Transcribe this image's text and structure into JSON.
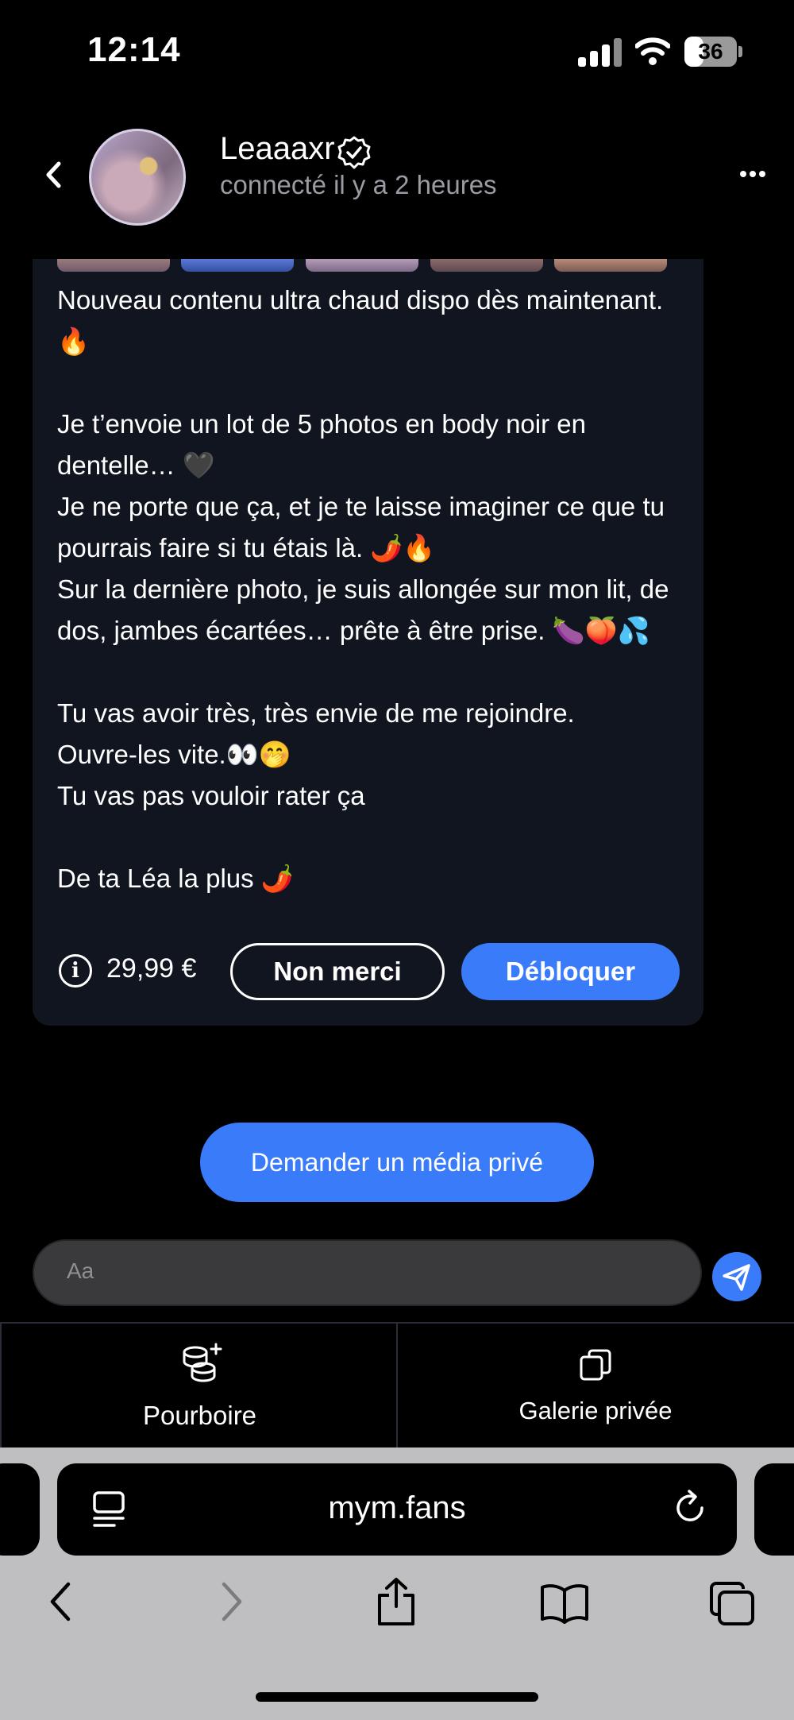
{
  "status_bar": {
    "time": "12:14",
    "battery": "36",
    "battery_level": 0.36
  },
  "header": {
    "back_icon": "chevron-left-icon",
    "name": "Leaaaxr",
    "verified_icon": "verified-badge-icon",
    "last_seen": "connecté il y a 2 heures",
    "more_icon": "ellipsis-icon"
  },
  "message": {
    "text": "Nouveau contenu ultra chaud dispo dès maintenant. 🔥\n\nJe t’envoie un lot de 5 photos en body noir en dentelle… 🖤\nJe ne porte que ça, et je te laisse imaginer ce que tu pourrais faire si tu étais là. 🌶️🔥\nSur la dernière photo, je suis allongée sur mon lit, de dos, jambes écartées… prête à être prise. 🍆🍑💦\n\nTu vas avoir très, très envie de me rejoindre.\nOuvre-les vite.👀🤭\nTu vas pas vouloir rater ça\n\nDe ta Léa la plus 🌶️",
    "price": "29,99 €",
    "decline_label": "Non merci",
    "unlock_label": "Débloquer"
  },
  "request_button": "Demander un média privé",
  "input": {
    "placeholder": "Aa"
  },
  "tabs": [
    {
      "label": "Pourboire",
      "icon": "coins-plus-icon"
    },
    {
      "label": "Galerie privée",
      "icon": "gallery-copy-icon"
    }
  ],
  "browser": {
    "url": "mym.fans",
    "nav": [
      "back-icon",
      "forward-icon",
      "share-icon",
      "bookmarks-icon",
      "tabs-icon"
    ]
  },
  "colors": {
    "accent": "#3a7bfa",
    "card_bg": "#11151f",
    "background": "#000000"
  }
}
